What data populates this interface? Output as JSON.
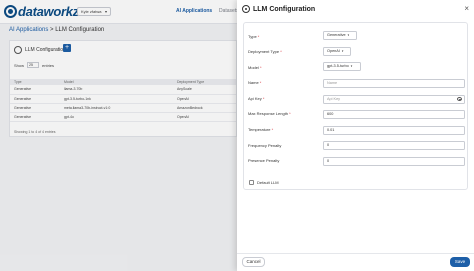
{
  "header": {
    "logo_text": "dataworkz",
    "project_select": "Kyle zfatwa",
    "nav": [
      "AI Applications",
      "Datasets"
    ]
  },
  "breadcrumb": {
    "root": "AI Applications",
    "separator": ">",
    "current": "LLM Configuration"
  },
  "card": {
    "title": "LLM Configuration",
    "show_prefix": "Show",
    "show_value": "25",
    "show_suffix": "entries",
    "columns": [
      "Type",
      "Model",
      "Deployment Type"
    ],
    "rows": [
      [
        "Generative",
        "llama-3.70b",
        "AnyScale"
      ],
      [
        "Generative",
        "gpt-3.5-turbo-1nk",
        "OpenAI"
      ],
      [
        "Generative",
        "meta.llama3-70b-instruct-v1:0",
        "AmazonBedrock"
      ],
      [
        "Generative",
        "gpt-4o",
        "OpenAI"
      ]
    ],
    "showing": "Showing 1 to 4 of 4 entries"
  },
  "drawer": {
    "title": "LLM Configuration",
    "fields": {
      "type": {
        "label": "Type",
        "value": "Generative"
      },
      "deployment_type": {
        "label": "Deployment Type",
        "value": "OpenAI"
      },
      "model": {
        "label": "Model",
        "value": "gpt-3.5-turbo"
      },
      "name": {
        "label": "Name",
        "placeholder": "Name"
      },
      "api_key": {
        "label": "Api Key",
        "placeholder": "Api Key"
      },
      "max_response_length": {
        "label": "Max Response Length",
        "value": "600"
      },
      "temperature": {
        "label": "Temperature",
        "value": "0.01"
      },
      "frequency_penalty": {
        "label": "Frequency Penalty",
        "value": "0"
      },
      "presence_penalty": {
        "label": "Presence Penalty",
        "value": "0"
      }
    },
    "default_llm_label": "Default LLM",
    "cancel_label": "Cancel",
    "save_label": "Save"
  },
  "colors": {
    "accent": "#1d5fa8",
    "required": "#d9363e"
  }
}
